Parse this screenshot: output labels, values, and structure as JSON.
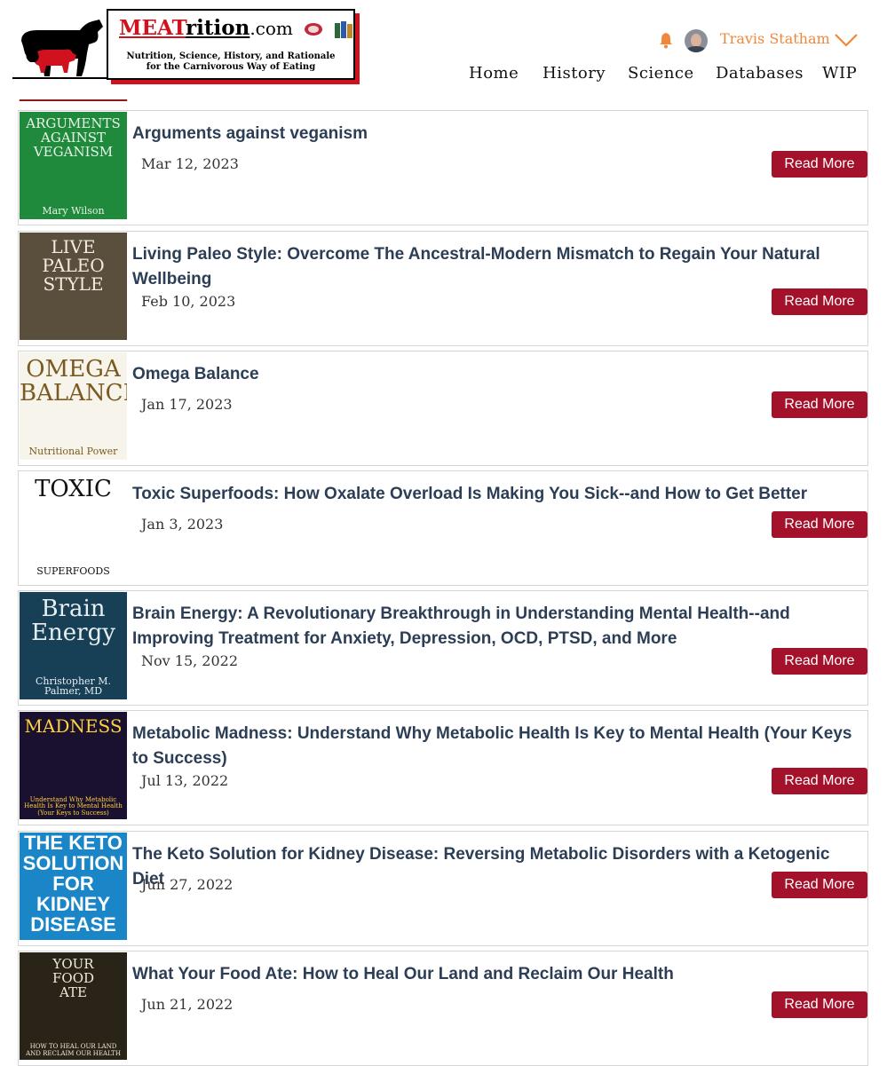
{
  "site": {
    "logo_main_red": "MEAT",
    "logo_main_black": "rition",
    "logo_domain": ".com",
    "tagline_line1": "Nutrition, Science, History, and Rationale",
    "tagline_line2": "for the Carnivorous Way of Eating"
  },
  "user": {
    "name": "Travis Statham",
    "bell_icon": "bell-icon",
    "chevron_icon": "chevron-down-icon"
  },
  "nav": {
    "items": [
      "Home",
      "History",
      "Science",
      "Databases",
      "WIP"
    ]
  },
  "colors": {
    "brand_red": "#a3112a",
    "title_navy": "#2c3e55",
    "user_orange": "#f0873a"
  },
  "read_more_label": "Read More",
  "books": [
    {
      "title": "Arguments against veganism",
      "date": "Mar 12, 2023",
      "cover": {
        "bg": "#1f8a3c",
        "fg": "#e8f3e8",
        "lines": [
          "ARGUMENTS",
          "AGAINST",
          "VEGANISM"
        ],
        "author": "Mary Wilson"
      }
    },
    {
      "title": "Living Paleo Style: Overcome The Ancestral-Modern Mismatch to Regain Your Natural Wellbeing",
      "date": "Feb 10, 2023",
      "cover": {
        "bg": "#5a4e3c",
        "fg": "#f2ece0",
        "lines": [
          "LIVE PALEO",
          "STYLE"
        ],
        "author": ""
      }
    },
    {
      "title": "Omega Balance",
      "date": "Jan 17, 2023",
      "cover": {
        "bg": "#f7f4ec",
        "fg": "#7a5a20",
        "lines": [
          "OMEGA",
          "BALANCE"
        ],
        "author": "Nutritional Power"
      }
    },
    {
      "title": "Toxic Superfoods: How Oxalate Overload Is Making You Sick--and How to Get Better",
      "date": "Jan 3, 2023",
      "cover": {
        "bg": "#ffffff",
        "fg": "#111111",
        "lines": [
          "TOXIC"
        ],
        "author": "SUPERFOODS"
      }
    },
    {
      "title": "Brain Energy: A Revolutionary Breakthrough in Understanding Mental Health--and Improving Treatment for Anxiety, Depression, OCD, PTSD, and More",
      "date": "Nov 15, 2022",
      "cover": {
        "bg": "#173f55",
        "fg": "#e6eef2",
        "lines": [
          "Brain",
          "Energy"
        ],
        "author": "Christopher M. Palmer, MD"
      }
    },
    {
      "title": "Metabolic Madness: Understand Why Metabolic Health Is Key to Mental Health (Your Keys to Success)",
      "date": "Jul 13, 2022",
      "cover": {
        "bg": "#1a1030",
        "fg": "#ffd23c",
        "lines": [
          "MADNESS"
        ],
        "author": "Understand Why Metabolic Health Is Key to Mental Health (Your Keys to Success)"
      }
    },
    {
      "title": "The Keto Solution for Kidney Disease: Reversing Metabolic Disorders with a Ketogenic Diet",
      "date": "Jun 27, 2022",
      "cover": {
        "bg": "#1a86c8",
        "fg": "#ffffff",
        "lines": [
          "THE KETO",
          "SOLUTION",
          "FOR",
          "KIDNEY",
          "DISEASE"
        ],
        "author": ""
      }
    },
    {
      "title": "What Your Food Ate: How to Heal Our Land and Reclaim Our Health",
      "date": "Jun 21, 2022",
      "cover": {
        "bg": "#2a2418",
        "fg": "#f1ead8",
        "lines": [
          "YOUR",
          "FOOD",
          "ATE"
        ],
        "author": "HOW TO HEAL OUR LAND AND RECLAIM OUR HEALTH"
      }
    }
  ]
}
